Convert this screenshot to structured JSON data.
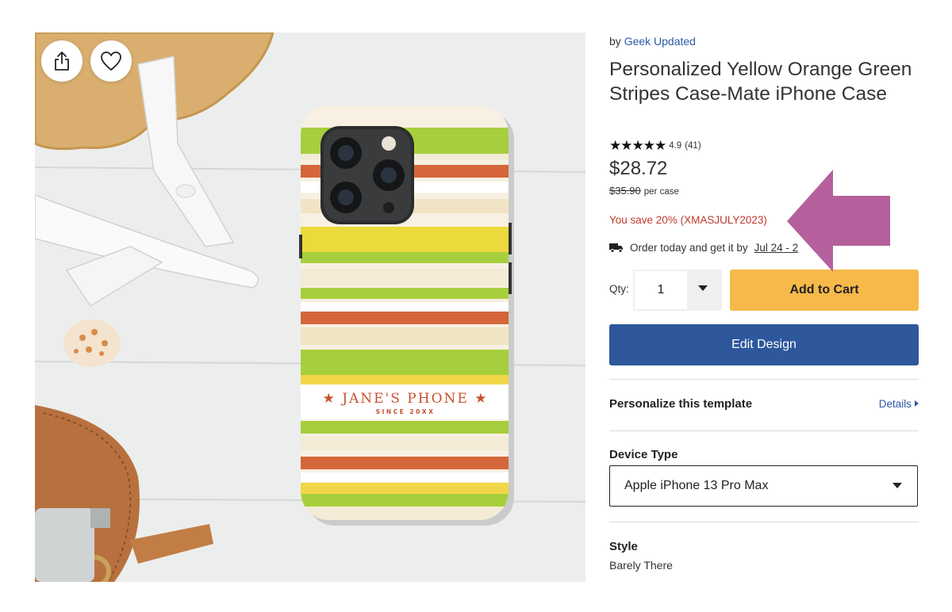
{
  "product": {
    "by_prefix": "by",
    "seller": "Geek Updated",
    "title": "Personalized Yellow Orange Green Stripes Case-Mate iPhone Case",
    "stars": "★★★★★",
    "rating": "4.9",
    "review_count": "(41)",
    "price": "$28.72",
    "original_price": "$35.90",
    "price_unit": "per case",
    "savings": "You save 20% (XMASJULY2023)",
    "delivery_prefix": "Order today and get it by",
    "delivery_date": "Jul 24 - 2",
    "case_text": "★ JANE'S PHONE ★",
    "case_subtext": "SINCE 20XX"
  },
  "purchase": {
    "qty_label": "Qty:",
    "qty_value": "1",
    "add_to_cart": "Add to Cart",
    "edit_design": "Edit Design"
  },
  "personalize": {
    "heading": "Personalize this template",
    "details_link": "Details"
  },
  "device": {
    "label": "Device Type",
    "selected": "Apple iPhone 13 Pro Max"
  },
  "style": {
    "label": "Style",
    "value": "Barely There"
  },
  "colors": {
    "link": "#2d5aa8",
    "save_red": "#c0392b",
    "cart_yellow": "#f6b94a",
    "edit_blue": "#2e579c",
    "annotation_arrow": "#b5609c"
  }
}
